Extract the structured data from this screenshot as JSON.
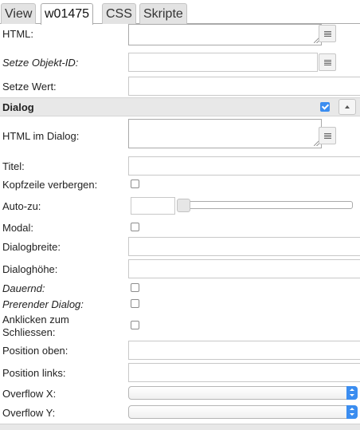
{
  "tabs": [
    {
      "label": "View"
    },
    {
      "label": "w01475"
    },
    {
      "label": "CSS"
    },
    {
      "label": "Skripte"
    }
  ],
  "fields": {
    "html": "HTML:",
    "objekt_id": "Setze Objekt-ID:",
    "wert": "Setze Wert:"
  },
  "dialog": {
    "title": "Dialog",
    "enabled": true,
    "html_im_dialog": "HTML im Dialog:",
    "titel": "Titel:",
    "kopfzeile": "Kopfzeile verbergen:",
    "auto_zu": "Auto-zu:",
    "modal": "Modal:",
    "breite": "Dialogbreite:",
    "hoehe": "Dialoghöhe:",
    "dauernd": "Dauernd:",
    "prerender": "Prerender Dialog:",
    "anklicken_1": "Anklicken zum",
    "anklicken_2": "Schliessen:",
    "pos_oben": "Position oben:",
    "pos_links": "Position links:",
    "overflow_x": "Overflow X:",
    "overflow_y": "Overflow Y:"
  },
  "colors": {
    "accent": "#3b8df0",
    "section_bg": "#e8e8e8"
  }
}
